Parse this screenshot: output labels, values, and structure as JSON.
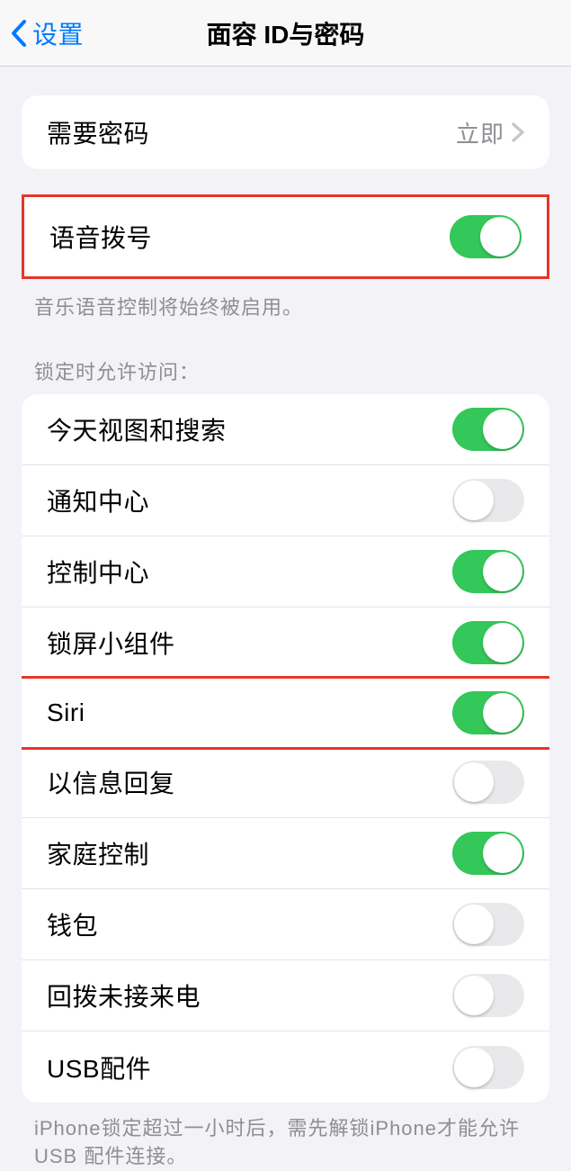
{
  "header": {
    "back_label": "设置",
    "title": "面容 ID与密码"
  },
  "require_passcode": {
    "label": "需要密码",
    "value": "立即"
  },
  "voice_dial": {
    "label": "语音拨号",
    "on": true
  },
  "voice_dial_footer": "音乐语音控制将始终被启用。",
  "access_header": "锁定时允许访问：",
  "access_items": [
    {
      "label": "今天视图和搜索",
      "on": true
    },
    {
      "label": "通知中心",
      "on": false
    },
    {
      "label": "控制中心",
      "on": true
    },
    {
      "label": "锁屏小组件",
      "on": true
    },
    {
      "label": "Siri",
      "on": true
    },
    {
      "label": "以信息回复",
      "on": false
    },
    {
      "label": "家庭控制",
      "on": true
    },
    {
      "label": "钱包",
      "on": false
    },
    {
      "label": "回拨未接来电",
      "on": false
    },
    {
      "label": "USB配件",
      "on": false
    }
  ],
  "bottom_note": "iPhone锁定超过一小时后，需先解锁iPhone才能允许USB 配件连接。"
}
